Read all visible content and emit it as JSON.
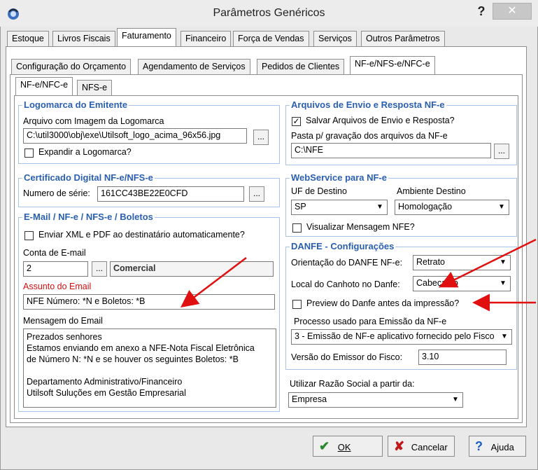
{
  "window": {
    "title": "Parâmetros Genéricos",
    "help": "?",
    "close": "✕"
  },
  "tabs_main": [
    "Estoque",
    "Livros Fiscais",
    "Faturamento",
    "Financeiro",
    "Força de Vendas",
    "Serviços",
    "Outros Parâmetros"
  ],
  "tabs_sub": [
    "Configuração do Orçamento",
    "Agendamento de Serviços",
    "Pedidos de Clientes",
    "NF-e/NFS-e/NFC-e"
  ],
  "tabs_sub2": [
    "NF-e/NFC-e",
    "NFS-e"
  ],
  "logomarca": {
    "title": "Logomarca do Emitente",
    "label": "Arquivo com Imagem da Logomarca",
    "path": "C:\\util3000\\obj\\exe\\Utilsoft_logo_acima_96x56.jpg",
    "expand_label": "Expandir a Logomarca?"
  },
  "certificado": {
    "title": "Certificado Digital NF-e/NFS-e",
    "label": "Numero de série:",
    "serial": "161CC43BE22E0CFD"
  },
  "email": {
    "title": "E-Mail / NF-e / NFS-e / Boletos",
    "send_label": "Enviar XML e PDF ao destinatário automaticamente?",
    "account_label": "Conta de E-mail",
    "account_value": "2",
    "account_name": "Comercial",
    "subject_label": "Assunto do Email",
    "subject_value": "NFE Número: *N e Boletos: *B",
    "message_label": "Mensagem do Email",
    "message": "Prezados senhores\nEstamos enviando em anexo a NFE-Nota Fiscal Eletrônica\nde Número N: *N e se houver os seguintes Boletos: *B\n\nDepartamento Administrativo/Financeiro\nUtilsoft Suluções em Gestão Empresarial"
  },
  "arquivos": {
    "title": "Arquivos de Envio e Resposta NF-e",
    "save_label": "Salvar Arquivos de Envio e Resposta?",
    "folder_label": "Pasta p/ gravação dos arquivos da NF-e",
    "folder": "C:\\NFE"
  },
  "webservice": {
    "title": "WebService para NF-e",
    "uf_label": "UF de Destino",
    "uf": "SP",
    "amb_label": "Ambiente Destino",
    "amb": "Homologação",
    "visualizar_label": "Visualizar Mensagem NFE?"
  },
  "danfe": {
    "title": "DANFE - Configurações",
    "orient_label": "Orientação do DANFE NF-e:",
    "orient": "Retrato",
    "canhoto_label": "Local do Canhoto no Danfe:",
    "canhoto": "Cabeçalho",
    "preview_label": "Preview do Danfe antes da impressão?",
    "processo_label": "Processo usado para Emissão da NF-e",
    "processo": "3 - Emissão de NF-e aplicativo fornecido pelo Fisco",
    "versao_label": "Versão do Emissor do Fisco:",
    "versao": "3.10"
  },
  "razao": {
    "label": "Utilizar Razão Social a partir da:",
    "value": "Empresa"
  },
  "buttons": {
    "ok": "OK",
    "cancel": "Cancelar",
    "help": "Ajuda"
  },
  "icons": {
    "ok": "check-icon",
    "cancel": "x-icon",
    "help": "question-icon",
    "ellipsis": "..."
  }
}
